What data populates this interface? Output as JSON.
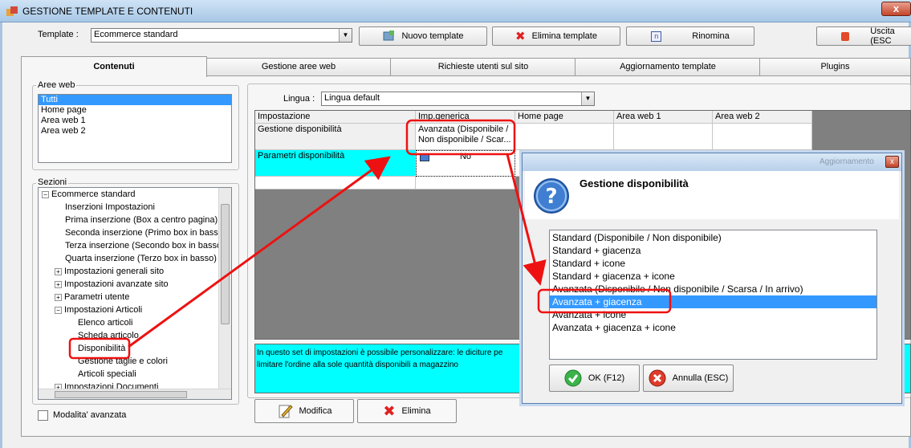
{
  "window": {
    "title": "GESTIONE TEMPLATE E CONTENUTI",
    "close_glyph": "x"
  },
  "toolbar": {
    "template_label": "Template :",
    "template_value": "Ecommerce standard",
    "new_template": "Nuovo template",
    "delete_template": "Elimina template",
    "rename": "Rinomina",
    "exit": "Uscita (ESC"
  },
  "tabs": [
    {
      "label": "Contenuti",
      "active": true
    },
    {
      "label": "Gestione aree web"
    },
    {
      "label": "Richieste utenti sul sito"
    },
    {
      "label": "Aggiornamento template"
    },
    {
      "label": "Plugins"
    }
  ],
  "aree_web": {
    "label": "Aree web",
    "items": [
      "Tutti",
      "Home page",
      "Area web 1",
      "Area web 2"
    ],
    "selected": "Tutti"
  },
  "sezioni": {
    "label": "Sezioni",
    "tree": [
      {
        "text": "Ecommerce standard",
        "pm": "-"
      },
      {
        "text": "Inserzioni Impostazioni"
      },
      {
        "text": "Prima inserzione (Box a centro pagina)"
      },
      {
        "text": "Seconda inserzione (Primo box in basso)"
      },
      {
        "text": "Terza inserzione (Secondo box in basso"
      },
      {
        "text": "Quarta inserzione (Terzo box in basso)"
      },
      {
        "text": "Impostazioni generali sito",
        "pm": "+"
      },
      {
        "text": "Impostazioni avanzate sito",
        "pm": "+"
      },
      {
        "text": "Parametri utente",
        "pm": "+"
      },
      {
        "text": "Impostazioni Articoli",
        "pm": "-"
      },
      {
        "text": "Elenco articoli"
      },
      {
        "text": "Scheda articolo"
      },
      {
        "text": "Disponibilità"
      },
      {
        "text": "Gestione taglie e colori"
      },
      {
        "text": "Articoli speciali"
      },
      {
        "text": "Impostazioni Documenti",
        "pm": "+"
      }
    ],
    "advanced_mode": "Modalita' avanzata"
  },
  "lingua": {
    "label": "Lingua :",
    "value": "Lingua default"
  },
  "grid": {
    "headers": [
      "Impostazione",
      "Imp.generica",
      "Home page",
      "Area web 1",
      "Area web 2"
    ],
    "rows": [
      {
        "name": "Gestione disponibilità",
        "value": "Avanzata (Disponibile / Non disponibile / Scar..."
      },
      {
        "name": "Parametri disponibilità",
        "value": "No"
      }
    ]
  },
  "description": "In questo set di impostazioni è possibile personalizzare: le diciture pe limitare l'ordine alla sole quantità disponibili a magazzino",
  "actions": {
    "edit": "Modifica",
    "delete": "Elimina"
  },
  "dialog": {
    "bg_text": "Aggiornamento",
    "title": "Gestione disponibilità",
    "options": [
      "Standard (Disponibile / Non disponibile)",
      "Standard + giacenza",
      "Standard + icone",
      "Standard + giacenza + icone",
      "Avanzata (Disponibile / Non disponibile / Scarsa / In arrivo)",
      "Avanzata + giacenza",
      "Avanzata + icone",
      "Avanzata + giacenza + icone"
    ],
    "selected": "Avanzata + giacenza",
    "ok": "OK (F12)",
    "cancel": "Annulla (ESC)"
  },
  "colors": {
    "highlight": "#3399ff",
    "cyan": "#00ffff",
    "annotation": "#ee1111"
  }
}
